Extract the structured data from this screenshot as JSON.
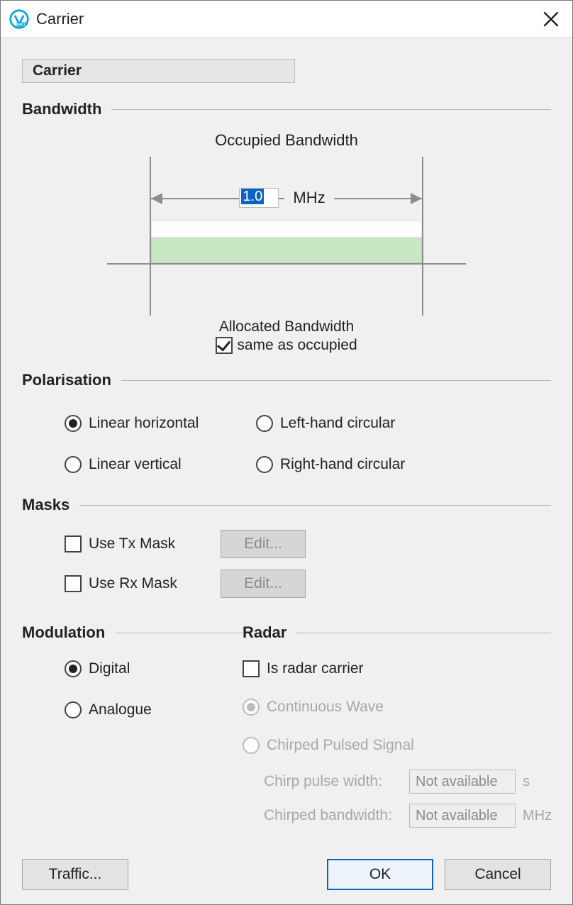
{
  "window": {
    "title": "Carrier"
  },
  "tab": {
    "label": "Carrier"
  },
  "bandwidth": {
    "section": "Bandwidth",
    "occupied_label": "Occupied Bandwidth",
    "value": "1.0",
    "unit": "MHz",
    "allocated_label": "Allocated Bandwidth",
    "same_as_occupied_label": "same as occupied",
    "same_as_occupied_checked": true
  },
  "polarisation": {
    "section": "Polarisation",
    "options": {
      "linear_horizontal": "Linear horizontal",
      "linear_vertical": "Linear vertical",
      "left_hand_circular": "Left-hand circular",
      "right_hand_circular": "Right-hand circular"
    },
    "selected": "linear_horizontal"
  },
  "masks": {
    "section": "Masks",
    "use_tx_label": "Use Tx Mask",
    "use_tx_checked": false,
    "use_rx_label": "Use Rx Mask",
    "use_rx_checked": false,
    "edit_label": "Edit..."
  },
  "modulation": {
    "section": "Modulation",
    "digital": "Digital",
    "analogue": "Analogue",
    "selected": "digital"
  },
  "radar": {
    "section": "Radar",
    "is_radar_label": "Is radar carrier",
    "is_radar_checked": false,
    "continuous_wave": "Continuous Wave",
    "chirped_pulsed": "Chirped Pulsed Signal",
    "radar_type_selected": "continuous_wave",
    "chirp_pulse_width_label": "Chirp pulse width:",
    "chirp_pulse_width_value": "Not available",
    "chirp_pulse_width_unit": "s",
    "chirped_bw_label": "Chirped bandwidth:",
    "chirped_bw_value": "Not available",
    "chirped_bw_unit": "MHz"
  },
  "footer": {
    "traffic": "Traffic...",
    "ok": "OK",
    "cancel": "Cancel"
  }
}
